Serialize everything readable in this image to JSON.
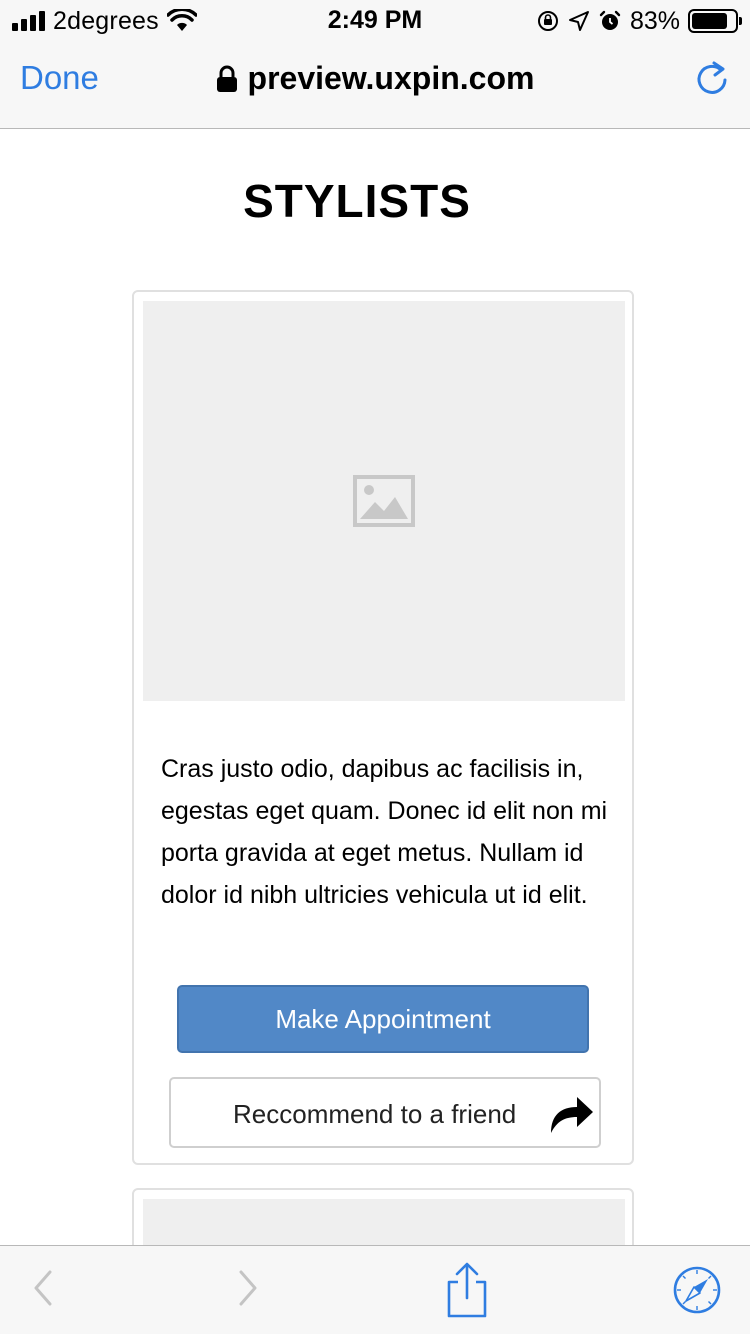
{
  "status_bar": {
    "carrier": "2degrees",
    "time": "2:49 PM",
    "battery_percent": "83%",
    "battery_level": 0.83,
    "icons": [
      "signal-icon",
      "wifi-icon",
      "orientation-lock-icon",
      "location-icon",
      "alarm-icon",
      "battery-icon"
    ]
  },
  "browser": {
    "done_label": "Done",
    "url": "preview.uxpin.com",
    "accent_color": "#2f7de1",
    "icons": [
      "lock-icon",
      "reload-icon"
    ]
  },
  "page": {
    "title": "STYLISTS",
    "cards": [
      {
        "image_icon": "image-placeholder-icon",
        "description": "Cras justo odio, dapibus ac facilisis in, egestas eget quam. Donec id elit non mi porta gravida at eget metus. Nullam id dolor id nibh ultricies vehicula ut id elit.",
        "primary_button": "Make Appointment",
        "secondary_button": "Reccommend to a friend",
        "secondary_icon": "share-arrow-icon"
      }
    ],
    "button_color": "#5188c7"
  },
  "toolbar": {
    "items": [
      "back-icon",
      "forward-icon",
      "share-icon",
      "compass-icon"
    ]
  }
}
